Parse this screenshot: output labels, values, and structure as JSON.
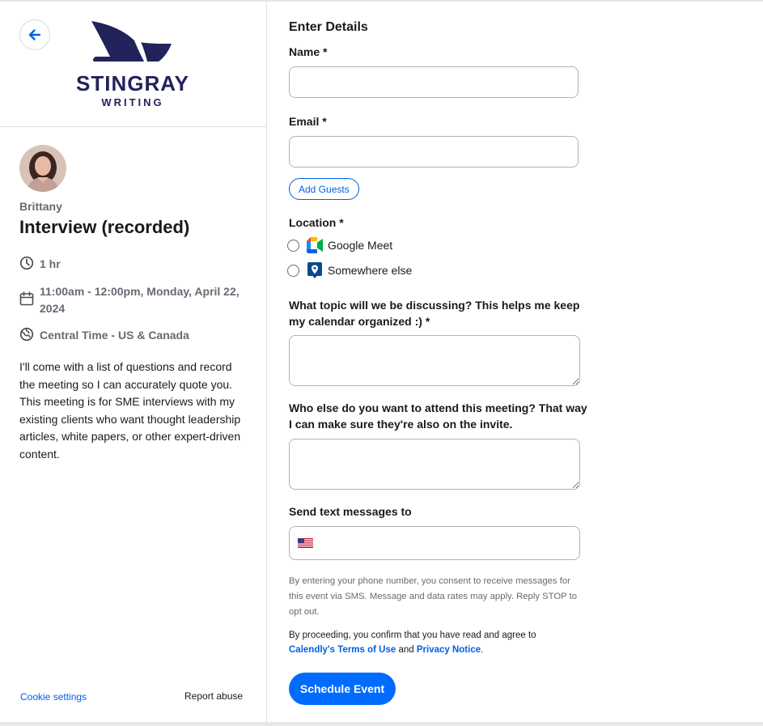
{
  "brand": {
    "name": "STINGRAY",
    "subtitle": "WRITING",
    "color": "#22235b"
  },
  "event": {
    "host": "Brittany",
    "title": "Interview (recorded)",
    "duration": "1 hr",
    "datetime": "11:00am - 12:00pm, Monday, April 22, 2024",
    "timezone": "Central Time - US & Canada",
    "description": "I'll come with a list of questions and record the meeting so I can accurately quote you. This meeting is for SME interviews with my existing clients who want thought leadership articles, white papers, or other expert-driven content."
  },
  "footer": {
    "cookie_settings": "Cookie settings",
    "report_abuse": "Report abuse"
  },
  "form": {
    "heading": "Enter Details",
    "name_label": "Name *",
    "name_value": "",
    "email_label": "Email *",
    "email_value": "",
    "add_guests": "Add Guests",
    "location_label": "Location *",
    "location_options": [
      {
        "label": "Google Meet",
        "icon": "google-meet-icon",
        "selected": false
      },
      {
        "label": "Somewhere else",
        "icon": "map-pin-icon",
        "selected": false
      }
    ],
    "topic_label": "What topic will we be discussing? This helps me keep my calendar organized :) *",
    "topic_value": "",
    "attendees_label": "Who else do you want to attend this meeting? That way I can make sure they're also on the invite.",
    "attendees_value": "",
    "sms_label": "Send text messages to",
    "sms_country": "US",
    "sms_value": "",
    "sms_consent": "By entering your phone number, you consent to receive messages for this event via SMS. Message and data rates may apply. Reply STOP to opt out.",
    "legal_prefix": "By proceeding, you confirm that you have read and agree to",
    "terms_link": "Calendly's Terms of Use",
    "legal_and": "and",
    "privacy_link": "Privacy Notice",
    "legal_suffix": ".",
    "submit": "Schedule Event"
  },
  "colors": {
    "accent": "#006bff",
    "link": "#0060e6",
    "muted_text": "#666a73"
  }
}
